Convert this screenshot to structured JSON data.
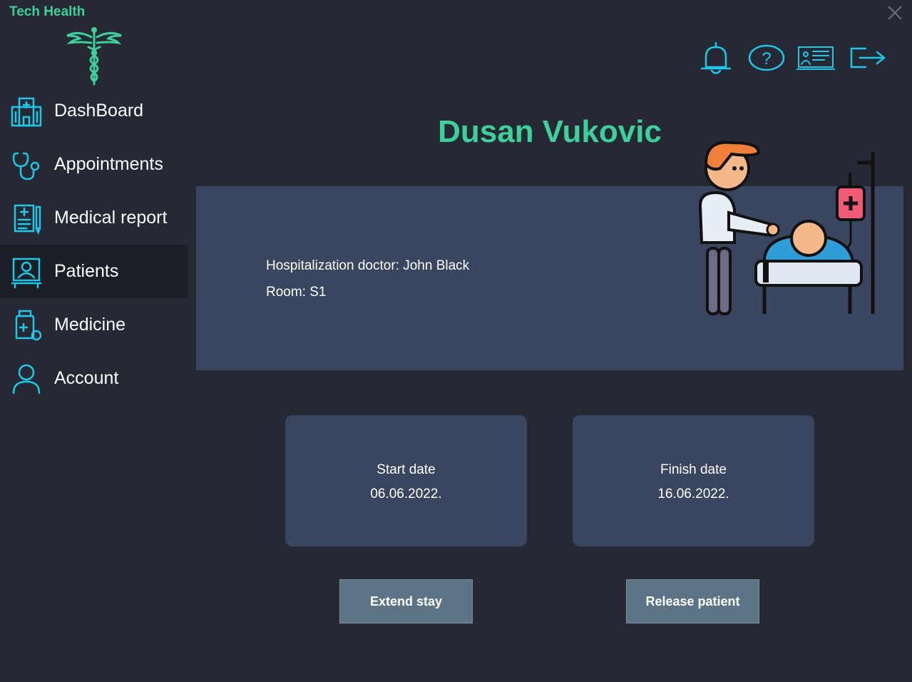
{
  "app": {
    "title": "Tech Health"
  },
  "colors": {
    "accent": "#3dd09a",
    "icon_cyan": "#1ec8e8",
    "panel": "#3a4560",
    "background": "#262834",
    "button": "#5c7486"
  },
  "icons": {
    "close": "close-icon",
    "logo": "caduceus-icon",
    "notifications": "bell-icon",
    "help": "help-icon",
    "presentation": "presentation-icon",
    "logout": "logout-icon"
  },
  "sidebar": {
    "items": [
      {
        "label": "DashBoard",
        "icon": "hospital-icon",
        "active": false
      },
      {
        "label": "Appointments",
        "icon": "stethoscope-icon",
        "active": false
      },
      {
        "label": "Medical report",
        "icon": "medical-report-icon",
        "active": false
      },
      {
        "label": "Patients",
        "icon": "patient-icon",
        "active": true
      },
      {
        "label": "Medicine",
        "icon": "medicine-icon",
        "active": false
      },
      {
        "label": "Account",
        "icon": "user-icon",
        "active": false
      }
    ]
  },
  "patient": {
    "name": "Dusan Vukovic",
    "doctor_line": "Hospitalization doctor: John Black",
    "room_line": "Room: S1"
  },
  "dates": {
    "start_label": "Start date",
    "start_value": "06.06.2022.",
    "finish_label": "Finish date",
    "finish_value": "16.06.2022."
  },
  "buttons": {
    "extend": "Extend stay",
    "release": "Release patient"
  }
}
